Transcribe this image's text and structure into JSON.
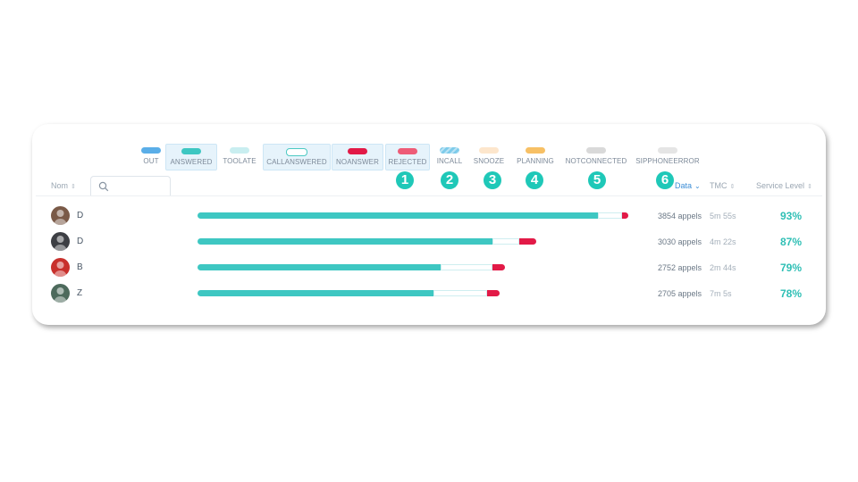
{
  "legend": [
    {
      "label": "OUT",
      "color": "#5aaee8",
      "active": false
    },
    {
      "label": "ANSWERED",
      "color": "#3ec7c2",
      "active": true
    },
    {
      "label": "TOOLATE",
      "color": "#c9eef0",
      "active": false
    },
    {
      "label": "CALLANSWERED",
      "color": "#ffffff",
      "active": true
    },
    {
      "label": "NOANSWER",
      "color": "#e21a47",
      "active": true
    },
    {
      "label": "REJECTED",
      "color": "#ee5c77",
      "active": true
    },
    {
      "label": "INCALL",
      "color": "#7ecbea",
      "active": false
    },
    {
      "label": "SNOOZE",
      "color": "#fde6cc",
      "active": false
    },
    {
      "label": "PLANNING",
      "color": "#f7c065",
      "active": false
    },
    {
      "label": "NOTCONNECTED",
      "color": "#d9d9d9",
      "active": false
    },
    {
      "label": "SIPPHONEERROR",
      "color": "#e5e5e5",
      "active": false
    }
  ],
  "badges": [
    "1",
    "2",
    "3",
    "4",
    "5",
    "6"
  ],
  "header": {
    "name_label": "Nom",
    "data_label": "Data",
    "tmc_label": "TMC",
    "service_level_label": "Service Level",
    "search_icon": "search-icon"
  },
  "rows": [
    {
      "initial": "D",
      "calls": "3854 appels",
      "tmc": "5m 55s",
      "service_level": "93%",
      "answered": 0.93,
      "callanswered": 0.055,
      "noanswer": 0.015,
      "scale": 1.0
    },
    {
      "initial": "D",
      "calls": "3030 appels",
      "tmc": "4m 22s",
      "service_level": "87%",
      "answered": 0.87,
      "callanswered": 0.08,
      "noanswer": 0.05,
      "scale": 0.786
    },
    {
      "initial": "B",
      "calls": "2752 appels",
      "tmc": "2m 44s",
      "service_level": "79%",
      "answered": 0.79,
      "callanswered": 0.17,
      "noanswer": 0.04,
      "scale": 0.714
    },
    {
      "initial": "Z",
      "calls": "2705 appels",
      "tmc": "7m 5s",
      "service_level": "78%",
      "answered": 0.78,
      "callanswered": 0.18,
      "noanswer": 0.04,
      "scale": 0.702
    }
  ]
}
